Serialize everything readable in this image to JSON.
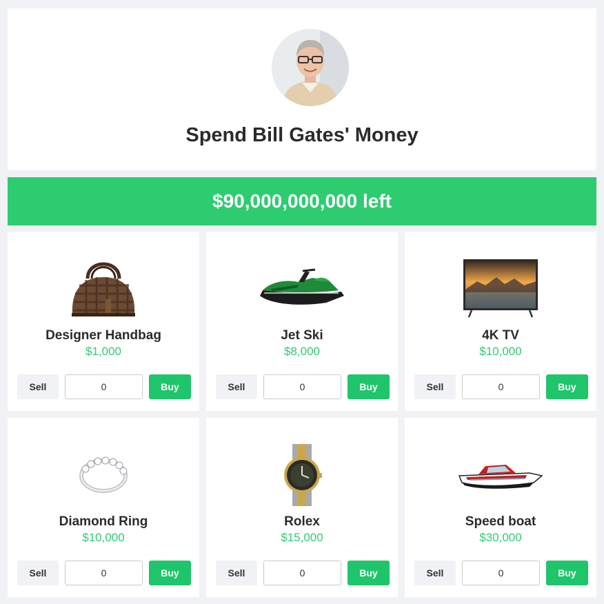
{
  "header": {
    "title": "Spend Bill Gates' Money",
    "avatar_icon": "person-portrait-icon"
  },
  "money": {
    "text": "$90,000,000,000 left"
  },
  "colors": {
    "accent": "#2ecc71",
    "buy": "#1fc56a",
    "price": "#2ecc71",
    "background": "#f1f2f6"
  },
  "items": [
    {
      "name": "Designer Handbag",
      "price": "$1,000",
      "quantity": "0",
      "sell_label": "Sell",
      "buy_label": "Buy",
      "icon": "handbag-icon"
    },
    {
      "name": "Jet Ski",
      "price": "$8,000",
      "quantity": "0",
      "sell_label": "Sell",
      "buy_label": "Buy",
      "icon": "jet-ski-icon"
    },
    {
      "name": "4K TV",
      "price": "$10,000",
      "quantity": "0",
      "sell_label": "Sell",
      "buy_label": "Buy",
      "icon": "tv-icon"
    },
    {
      "name": "Diamond Ring",
      "price": "$10,000",
      "quantity": "0",
      "sell_label": "Sell",
      "buy_label": "Buy",
      "icon": "ring-icon"
    },
    {
      "name": "Rolex",
      "price": "$15,000",
      "quantity": "0",
      "sell_label": "Sell",
      "buy_label": "Buy",
      "icon": "watch-icon"
    },
    {
      "name": "Speed boat",
      "price": "$30,000",
      "quantity": "0",
      "sell_label": "Sell",
      "buy_label": "Buy",
      "icon": "speedboat-icon"
    }
  ]
}
